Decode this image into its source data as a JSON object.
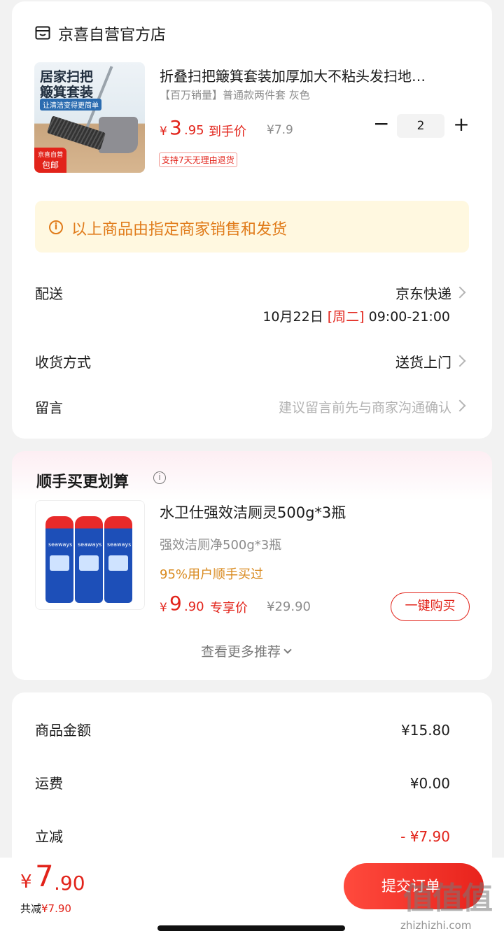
{
  "store": {
    "name": "京喜自营官方店",
    "icon": "store-icon"
  },
  "product": {
    "image_texts": {
      "line1": "居家扫把",
      "line2": "簸箕套装",
      "tagline": "让清洁变得更简单",
      "badge_top": "京喜自营",
      "badge_bottom": "包邮"
    },
    "title": "折叠扫把簸箕套装加厚加大不粘头发扫地…",
    "spec": "【百万销量】普通款两件套 灰色",
    "price": {
      "symbol": "¥",
      "integer": "3",
      "decimal": ".95",
      "tag": "到手价",
      "original": "¥7.9"
    },
    "return_policy": "支持7天无理由退货",
    "quantity": {
      "minus": "−",
      "value": "2",
      "plus": "+"
    }
  },
  "notice": "以上商品由指定商家销售和发货",
  "delivery": {
    "label": "配送",
    "value": "京东快递",
    "date": "10月22日",
    "weekday": "[周二]",
    "time": "09:00-21:00"
  },
  "receive_method": {
    "label": "收货方式",
    "value": "送货上门"
  },
  "message": {
    "label": "留言",
    "placeholder": "建议留言前先与商家沟通确认"
  },
  "recommend": {
    "title": "顺手买更划算",
    "product": {
      "image_label": "seaways",
      "title": "水卫仕强效洁厕灵500g*3瓶",
      "spec": "强效洁厕净500g*3瓶",
      "social": "95%用户顺手买过",
      "price": {
        "symbol": "¥",
        "integer": "9",
        "decimal": ".90",
        "tag": "专享价",
        "original": "¥29.90"
      },
      "buy_label": "一键购买"
    },
    "more_label": "查看更多推荐"
  },
  "summary": [
    {
      "label": "商品金额",
      "value": "¥15.80",
      "highlight": false
    },
    {
      "label": "运费",
      "value": "¥0.00",
      "highlight": false
    },
    {
      "label": "立减",
      "value": "- ¥7.90",
      "highlight": true
    }
  ],
  "bottom": {
    "total": {
      "symbol": "¥",
      "integer": "7",
      "decimal": ".90"
    },
    "saved_label": "共减",
    "saved_value": "¥7.90",
    "submit_label": "提交订单"
  },
  "watermark": {
    "logo": "值值值",
    "site": "zhizhizhi.com"
  },
  "colors": {
    "accent_red": "#e2231a",
    "notice_bg": "#fff8e0",
    "notice_text": "#e07b1a",
    "social_orange": "#d98a1f",
    "page_bg": "#f2f2f2"
  }
}
